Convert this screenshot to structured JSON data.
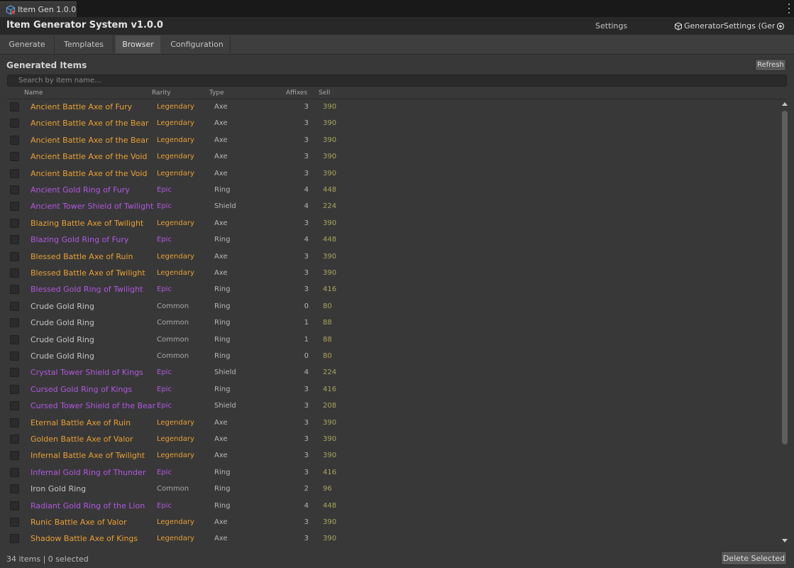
{
  "window": {
    "tab_title": "Item Gen 1.0.0",
    "tab_icon": "unity-cube-icon"
  },
  "header": {
    "title": "Item Generator System v1.0.0",
    "settings_label": "Settings",
    "settings_value": "GeneratorSettings (Gene"
  },
  "toolbar": {
    "tabs": [
      "Generate",
      "Templates",
      "Browser",
      "Configuration"
    ],
    "active_tab": "Browser"
  },
  "browser": {
    "section_title": "Generated Items",
    "refresh_label": "Refresh",
    "search_placeholder": "Search by item name...",
    "columns": {
      "name": "Name",
      "rarity": "Rarity",
      "type": "Type",
      "affixes": "Affixes",
      "sell": "Sell"
    },
    "rows": [
      {
        "name": "Ancient Battle Axe of Fury",
        "rarity": "Legendary",
        "type": "Axe",
        "affixes": "3",
        "sell": "390"
      },
      {
        "name": "Ancient Battle Axe of the Bear",
        "rarity": "Legendary",
        "type": "Axe",
        "affixes": "3",
        "sell": "390"
      },
      {
        "name": "Ancient Battle Axe of the Bear",
        "rarity": "Legendary",
        "type": "Axe",
        "affixes": "3",
        "sell": "390"
      },
      {
        "name": "Ancient Battle Axe of the Void",
        "rarity": "Legendary",
        "type": "Axe",
        "affixes": "3",
        "sell": "390"
      },
      {
        "name": "Ancient Battle Axe of the Void",
        "rarity": "Legendary",
        "type": "Axe",
        "affixes": "3",
        "sell": "390"
      },
      {
        "name": "Ancient Gold Ring of Fury",
        "rarity": "Epic",
        "type": "Ring",
        "affixes": "4",
        "sell": "448"
      },
      {
        "name": "Ancient Tower Shield of Twilight",
        "rarity": "Epic",
        "type": "Shield",
        "affixes": "4",
        "sell": "224"
      },
      {
        "name": "Blazing Battle Axe of Twilight",
        "rarity": "Legendary",
        "type": "Axe",
        "affixes": "3",
        "sell": "390"
      },
      {
        "name": "Blazing Gold Ring of Fury",
        "rarity": "Epic",
        "type": "Ring",
        "affixes": "4",
        "sell": "448"
      },
      {
        "name": "Blessed Battle Axe of Ruin",
        "rarity": "Legendary",
        "type": "Axe",
        "affixes": "3",
        "sell": "390"
      },
      {
        "name": "Blessed Battle Axe of Twilight",
        "rarity": "Legendary",
        "type": "Axe",
        "affixes": "3",
        "sell": "390"
      },
      {
        "name": "Blessed Gold Ring of Twilight",
        "rarity": "Epic",
        "type": "Ring",
        "affixes": "3",
        "sell": "416"
      },
      {
        "name": "Crude Gold Ring",
        "rarity": "Common",
        "type": "Ring",
        "affixes": "0",
        "sell": "80"
      },
      {
        "name": "Crude Gold Ring",
        "rarity": "Common",
        "type": "Ring",
        "affixes": "1",
        "sell": "88"
      },
      {
        "name": "Crude Gold Ring",
        "rarity": "Common",
        "type": "Ring",
        "affixes": "1",
        "sell": "88"
      },
      {
        "name": "Crude Gold Ring",
        "rarity": "Common",
        "type": "Ring",
        "affixes": "0",
        "sell": "80"
      },
      {
        "name": "Crystal Tower Shield of Kings",
        "rarity": "Epic",
        "type": "Shield",
        "affixes": "4",
        "sell": "224"
      },
      {
        "name": "Cursed Gold Ring of Kings",
        "rarity": "Epic",
        "type": "Ring",
        "affixes": "3",
        "sell": "416"
      },
      {
        "name": "Cursed Tower Shield of the Bear",
        "rarity": "Epic",
        "type": "Shield",
        "affixes": "3",
        "sell": "208"
      },
      {
        "name": "Eternal Battle Axe of Ruin",
        "rarity": "Legendary",
        "type": "Axe",
        "affixes": "3",
        "sell": "390"
      },
      {
        "name": "Golden Battle Axe of Valor",
        "rarity": "Legendary",
        "type": "Axe",
        "affixes": "3",
        "sell": "390"
      },
      {
        "name": "Infernal Battle Axe of Twilight",
        "rarity": "Legendary",
        "type": "Axe",
        "affixes": "3",
        "sell": "390"
      },
      {
        "name": "Infernal Gold Ring of Thunder",
        "rarity": "Epic",
        "type": "Ring",
        "affixes": "3",
        "sell": "416"
      },
      {
        "name": "Iron Gold Ring",
        "rarity": "Common",
        "type": "Ring",
        "affixes": "2",
        "sell": "96"
      },
      {
        "name": "Radiant Gold Ring of the Lion",
        "rarity": "Epic",
        "type": "Ring",
        "affixes": "4",
        "sell": "448"
      },
      {
        "name": "Runic Battle Axe of Valor",
        "rarity": "Legendary",
        "type": "Axe",
        "affixes": "3",
        "sell": "390"
      },
      {
        "name": "Shadow Battle Axe of Kings",
        "rarity": "Legendary",
        "type": "Axe",
        "affixes": "3",
        "sell": "390"
      }
    ]
  },
  "footer": {
    "status": "34 items | 0 selected",
    "delete_label": "Delete Selected"
  },
  "colors": {
    "legendary": "#e8a033",
    "epic": "#b158e0",
    "common": "#c4c4c4",
    "sell": "#a8a55c"
  }
}
